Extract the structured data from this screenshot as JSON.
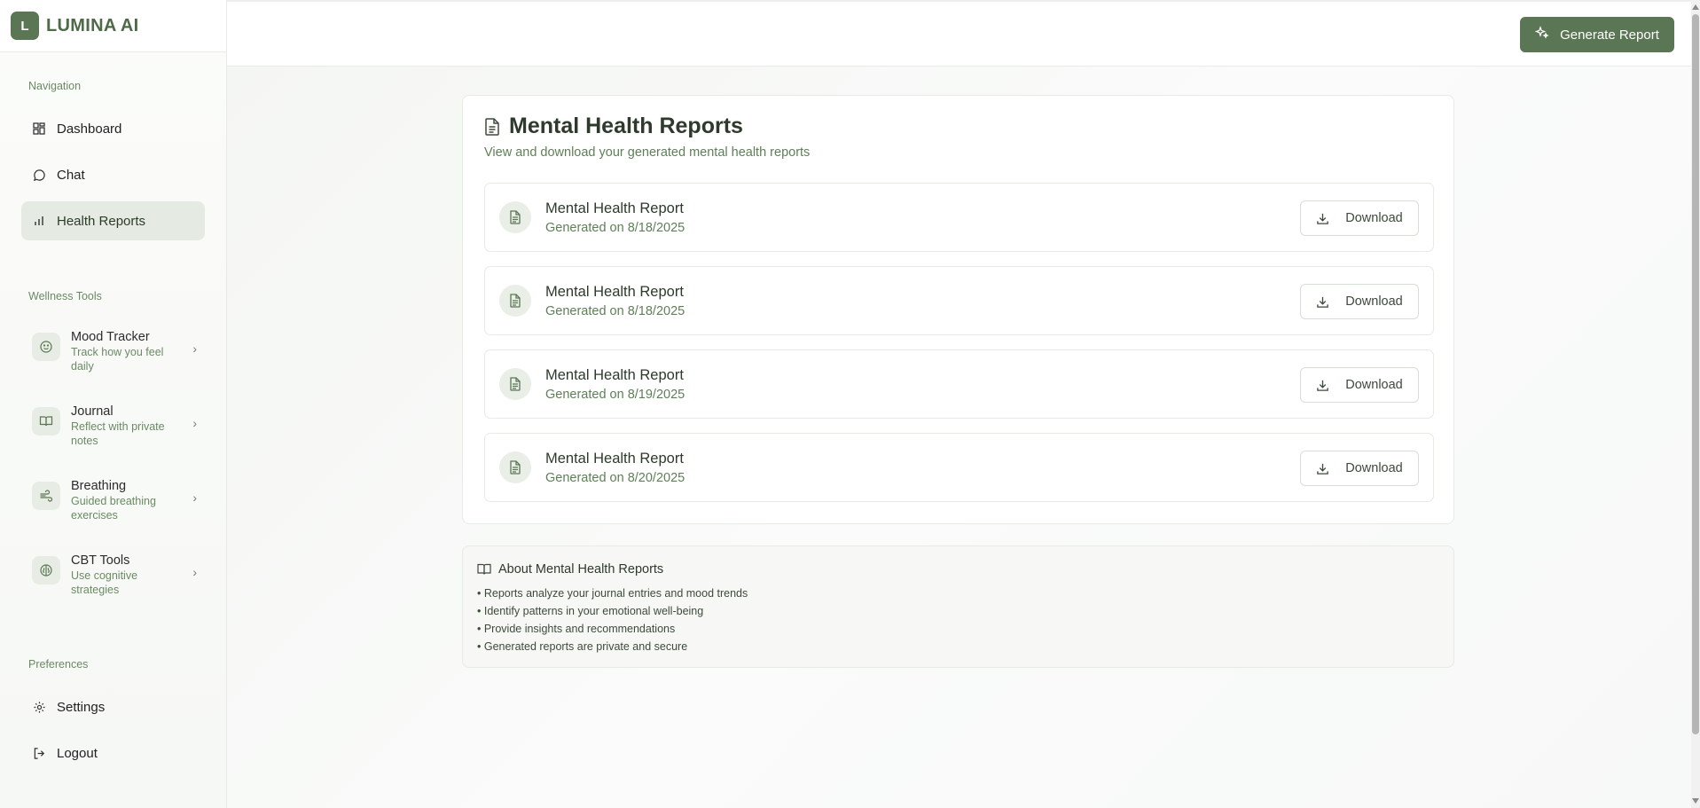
{
  "brand": {
    "logo_letter": "L",
    "name": "LUMINA AI"
  },
  "sidebar": {
    "navigation_label": "Navigation",
    "nav": [
      {
        "label": "Dashboard",
        "icon": "dashboard-icon"
      },
      {
        "label": "Chat",
        "icon": "chat-icon"
      },
      {
        "label": "Health Reports",
        "icon": "bar-chart-icon",
        "active": true
      }
    ],
    "wellness_label": "Wellness Tools",
    "tools": [
      {
        "title": "Mood Tracker",
        "desc": "Track how you feel daily",
        "icon": "smile-icon"
      },
      {
        "title": "Journal",
        "desc": "Reflect with private notes",
        "icon": "book-open-icon"
      },
      {
        "title": "Breathing",
        "desc": "Guided breathing exercises",
        "icon": "wind-icon"
      },
      {
        "title": "CBT Tools",
        "desc": "Use cognitive strategies",
        "icon": "brain-icon"
      }
    ],
    "preferences_label": "Preferences",
    "prefs": [
      {
        "label": "Settings",
        "icon": "gear-icon"
      },
      {
        "label": "Logout",
        "icon": "logout-icon"
      }
    ]
  },
  "topbar": {
    "generate_label": "Generate Report"
  },
  "reports_card": {
    "title": "Mental Health Reports",
    "subtitle": "View and download your generated mental health reports",
    "download_label": "Download",
    "reports": [
      {
        "title": "Mental Health Report",
        "date": "Generated on 8/18/2025"
      },
      {
        "title": "Mental Health Report",
        "date": "Generated on 8/18/2025"
      },
      {
        "title": "Mental Health Report",
        "date": "Generated on 8/19/2025"
      },
      {
        "title": "Mental Health Report",
        "date": "Generated on 8/20/2025"
      }
    ]
  },
  "about": {
    "title": "About Mental Health Reports",
    "items": [
      "• Reports analyze your journal entries and mood trends",
      "• Identify patterns in your emotional well-being",
      "• Provide insights and recommendations",
      "• Generated reports are private and secure"
    ]
  },
  "colors": {
    "accent": "#5b7654",
    "muted_text": "#5e7f57",
    "active_bg": "#e5ebe2"
  }
}
